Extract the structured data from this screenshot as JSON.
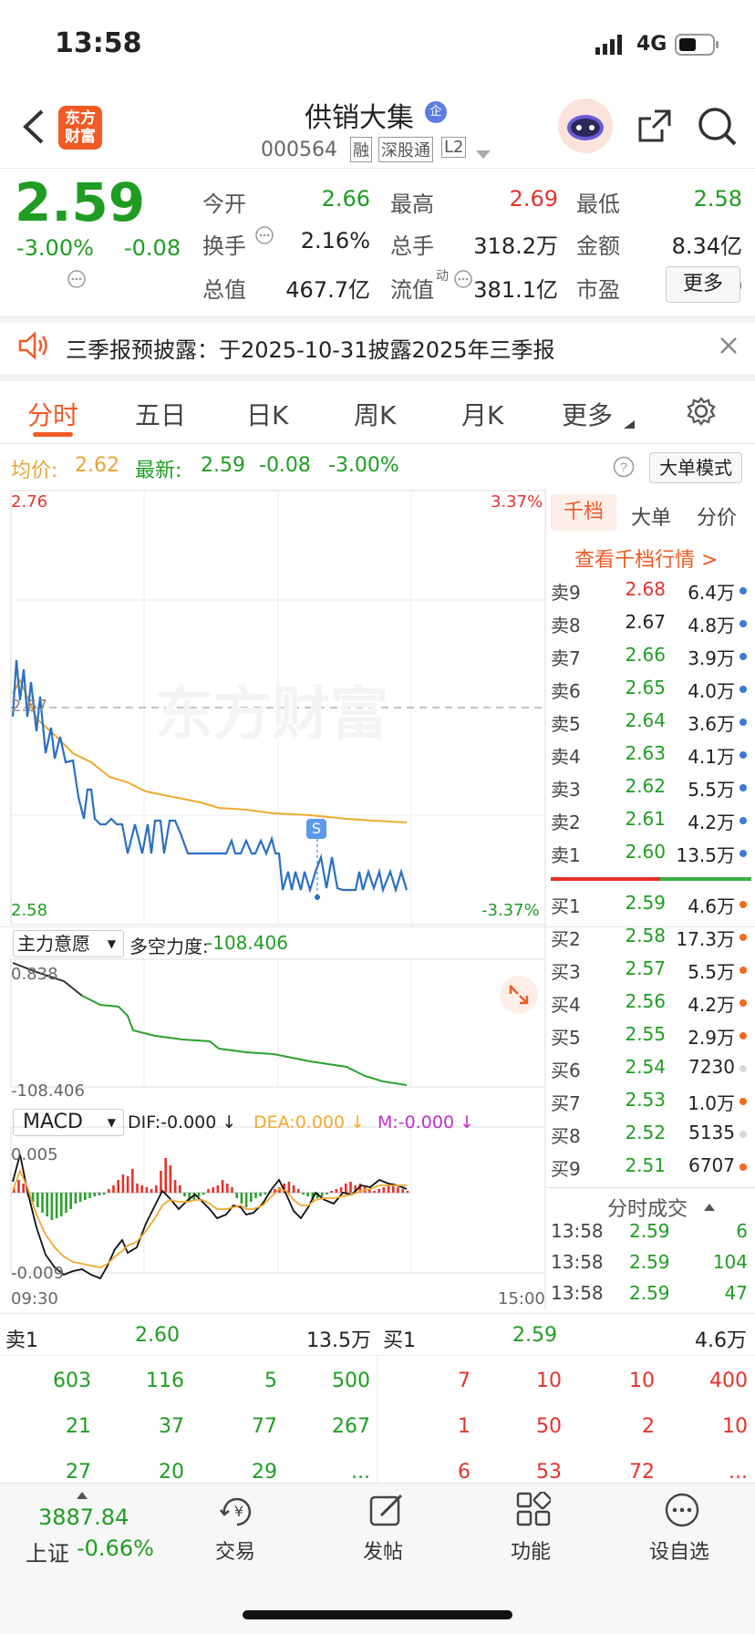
{
  "status": {
    "time": "13:58",
    "network": "4G"
  },
  "header": {
    "logo_line1": "东方",
    "logo_line2": "财富",
    "title": "供销大集",
    "title_badge": "企",
    "code": "000564",
    "tags": [
      "融",
      "深股通",
      "L2"
    ]
  },
  "quote": {
    "price": "2.59",
    "pct": "-3.00%",
    "chg": "-0.08",
    "stats": [
      {
        "label": "今开",
        "value": "2.66",
        "color": "#1f9d22"
      },
      {
        "label": "最高",
        "value": "2.69",
        "color": "#e5322d"
      },
      {
        "label": "最低",
        "value": "2.58",
        "color": "#1f9d22"
      },
      {
        "label": "换手",
        "value": "2.16%",
        "color": "#222222"
      },
      {
        "label": "总手",
        "value": "318.2万",
        "color": "#222222"
      },
      {
        "label": "金额",
        "value": "8.34亿",
        "color": "#222222"
      },
      {
        "label": "总值",
        "value": "467.7亿",
        "color": "#222222"
      },
      {
        "label": "流值",
        "value": "381.1亿",
        "color": "#222222"
      },
      {
        "label": "市盈",
        "value": "4391.50",
        "color": "#222222"
      }
    ],
    "pe_sup": "动",
    "more_btn": "更多"
  },
  "notice": {
    "text": "三季报预披露：于2025-10-31披露2025年三季报"
  },
  "tabs": [
    "分时",
    "五日",
    "日K",
    "周K",
    "月K",
    "更多"
  ],
  "info_bar": {
    "avg_label": "均价:",
    "avg_value": "2.62",
    "latest_label": "最新:",
    "latest_value": "2.59",
    "latest_chg": "-0.08",
    "latest_pct": "-3.00%",
    "mode_btn": "大单模式"
  },
  "chart_labels": {
    "top_price": "2.76",
    "top_pct": "3.37%",
    "mid_price": "2.67",
    "bottom_price": "2.58",
    "bottom_pct": "-3.37%",
    "watermark": "东方财富",
    "sell_marker": "S"
  },
  "indicator": {
    "name": "主力意愿",
    "label": "多空力度:",
    "value": "-108.406",
    "top": "0.838",
    "bottom": "-108.406"
  },
  "macd": {
    "name": "MACD",
    "dif": "DIF:-0.000 ↓",
    "dea": "DEA:0.000 ↓",
    "m": "M:-0.000 ↓",
    "top": "0.005",
    "bottom": "-0.009",
    "time_start": "09:30",
    "time_end": "15:00"
  },
  "side_tabs": [
    "千档",
    "大单",
    "分价"
  ],
  "side_link": "查看千档行情 >",
  "asks": [
    {
      "label": "卖9",
      "price": "2.68",
      "vol": "6.4万",
      "pc": "#e5322d"
    },
    {
      "label": "卖8",
      "price": "2.67",
      "vol": "4.8万",
      "pc": "#222222"
    },
    {
      "label": "卖7",
      "price": "2.66",
      "vol": "3.9万",
      "pc": "#1f9d22"
    },
    {
      "label": "卖6",
      "price": "2.65",
      "vol": "4.0万",
      "pc": "#1f9d22"
    },
    {
      "label": "卖5",
      "price": "2.64",
      "vol": "3.6万",
      "pc": "#1f9d22"
    },
    {
      "label": "卖4",
      "price": "2.63",
      "vol": "4.1万",
      "pc": "#1f9d22"
    },
    {
      "label": "卖3",
      "price": "2.62",
      "vol": "5.5万",
      "pc": "#1f9d22"
    },
    {
      "label": "卖2",
      "price": "2.61",
      "vol": "4.2万",
      "pc": "#1f9d22"
    },
    {
      "label": "卖1",
      "price": "2.60",
      "vol": "13.5万",
      "pc": "#1f9d22"
    }
  ],
  "bids": [
    {
      "label": "买1",
      "price": "2.59",
      "vol": "4.6万",
      "dot": "#f26a1b"
    },
    {
      "label": "买2",
      "price": "2.58",
      "vol": "17.3万",
      "dot": "#f26a1b"
    },
    {
      "label": "买3",
      "price": "2.57",
      "vol": "5.5万",
      "dot": "#f26a1b"
    },
    {
      "label": "买4",
      "price": "2.56",
      "vol": "4.2万",
      "dot": "#f26a1b"
    },
    {
      "label": "买5",
      "price": "2.55",
      "vol": "2.9万",
      "dot": "#f26a1b"
    },
    {
      "label": "买6",
      "price": "2.54",
      "vol": "7230",
      "dot": "#d9d9d9"
    },
    {
      "label": "买7",
      "price": "2.53",
      "vol": "1.0万",
      "dot": "#f26a1b"
    },
    {
      "label": "买8",
      "price": "2.52",
      "vol": "5135",
      "dot": "#d9d9d9"
    },
    {
      "label": "买9",
      "price": "2.51",
      "vol": "6707",
      "dot": "#f26a1b"
    }
  ],
  "trades_title": "分时成交",
  "trades": [
    {
      "time": "13:58",
      "price": "2.59",
      "vol": "6"
    },
    {
      "time": "13:58",
      "price": "2.59",
      "vol": "104"
    },
    {
      "time": "13:58",
      "price": "2.59",
      "vol": "47"
    }
  ],
  "queue": {
    "sell_label": "卖1",
    "sell_price": "2.60",
    "sell_vol": "13.5万",
    "buy_label": "买1",
    "buy_price": "2.59",
    "buy_vol": "4.6万",
    "sell_rows": [
      [
        "603",
        "116",
        "5",
        "500"
      ],
      [
        "21",
        "37",
        "77",
        "267"
      ],
      [
        "27",
        "20",
        "29",
        "..."
      ]
    ],
    "buy_rows": [
      [
        "7",
        "10",
        "10",
        "400"
      ],
      [
        "1",
        "50",
        "2",
        "10"
      ],
      [
        "6",
        "53",
        "72",
        "..."
      ]
    ]
  },
  "bottom_nav": {
    "index_value": "3887.84",
    "index_name": "上证",
    "index_pct": "-0.66%",
    "items": [
      "交易",
      "发帖",
      "功能",
      "设自选"
    ]
  }
}
